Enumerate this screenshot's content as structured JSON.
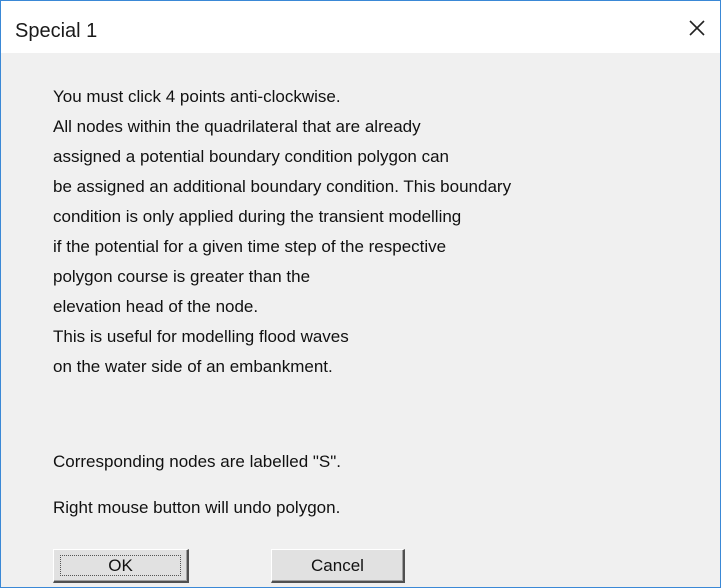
{
  "window": {
    "title": "Special 1",
    "close_icon": "close-icon"
  },
  "message": {
    "lines": [
      "You must click 4 points anti-clockwise.",
      "All nodes within the quadrilateral that are already",
      "assigned a potential boundary condition polygon can",
      "be assigned an additional boundary condition. This boundary",
      "condition is only applied during the transient modelling",
      "if the potential for a given time step of the respective",
      "polygon course is greater than the",
      "elevation head of the node.",
      "This is useful for modelling flood waves",
      "on the water side of an embankment."
    ],
    "nodes_note": "Corresponding nodes are labelled \"S\".",
    "undo_note": "Right mouse button will undo polygon."
  },
  "buttons": {
    "ok_label": "OK",
    "cancel_label": "Cancel"
  },
  "colors": {
    "titlebar": "#ffffff",
    "client": "#f0f0f0",
    "border": "#3a88d6"
  }
}
